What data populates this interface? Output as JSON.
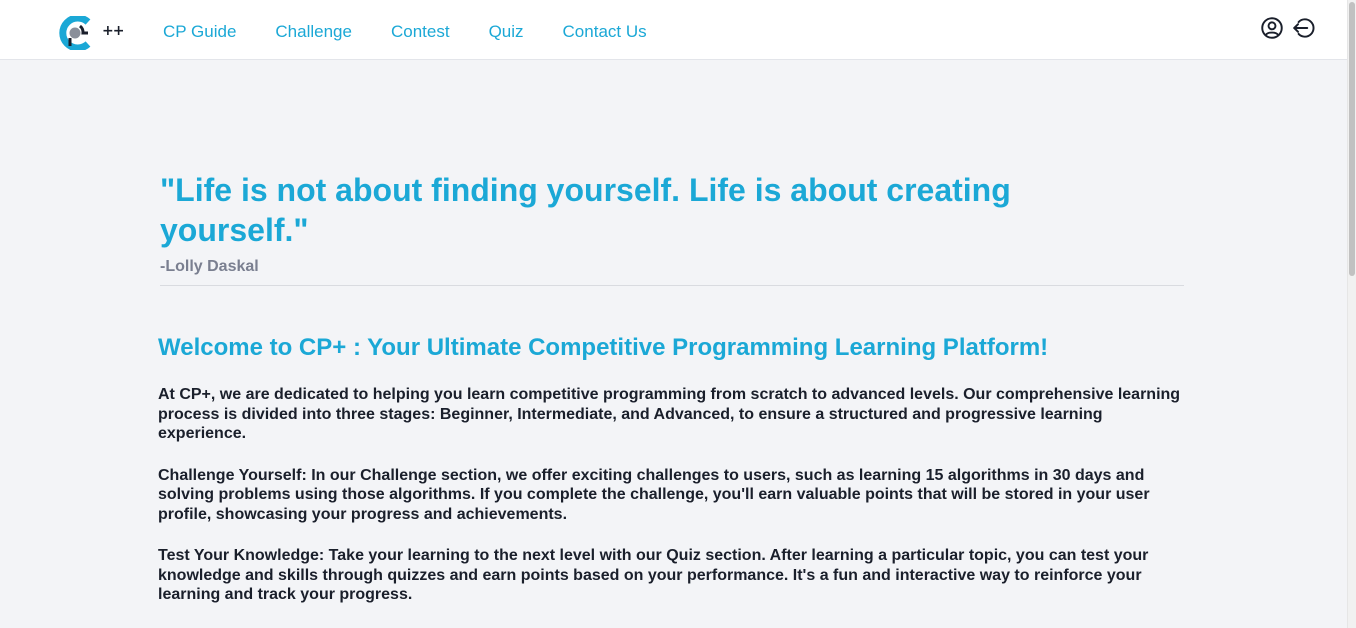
{
  "nav": {
    "logo_plus": "++",
    "links": [
      "CP Guide",
      "Challenge",
      "Contest",
      "Quiz",
      "Contact Us"
    ]
  },
  "icons": {
    "profile": "user-circle-icon",
    "logout": "logout-icon"
  },
  "colors": {
    "accent": "#1ba8d6",
    "text": "#1a1f2b",
    "muted": "#7a7f90",
    "background": "#f3f4f7"
  },
  "quote": {
    "text": "\"Life is not about finding yourself. Life is about creating yourself.\"",
    "author": "-Lolly Daskal"
  },
  "welcome": {
    "title": "Welcome to CP+ : Your Ultimate Competitive Programming Learning Platform!",
    "paragraphs": [
      "At CP+, we are dedicated to helping you learn competitive programming from scratch to advanced levels. Our comprehensive learning process is divided into three stages: Beginner, Intermediate, and Advanced, to ensure a structured and progressive learning experience.",
      "Challenge Yourself: In our Challenge section, we offer exciting challenges to users, such as learning 15 algorithms in 30 days and solving problems using those algorithms. If you complete the challenge, you'll earn valuable points that will be stored in your user profile, showcasing your progress and achievements.",
      "Test Your Knowledge: Take your learning to the next level with our Quiz section. After learning a particular topic, you can test your knowledge and skills through quizzes and earn points based on your performance. It's a fun and interactive way to reinforce your learning and track your progress."
    ]
  }
}
